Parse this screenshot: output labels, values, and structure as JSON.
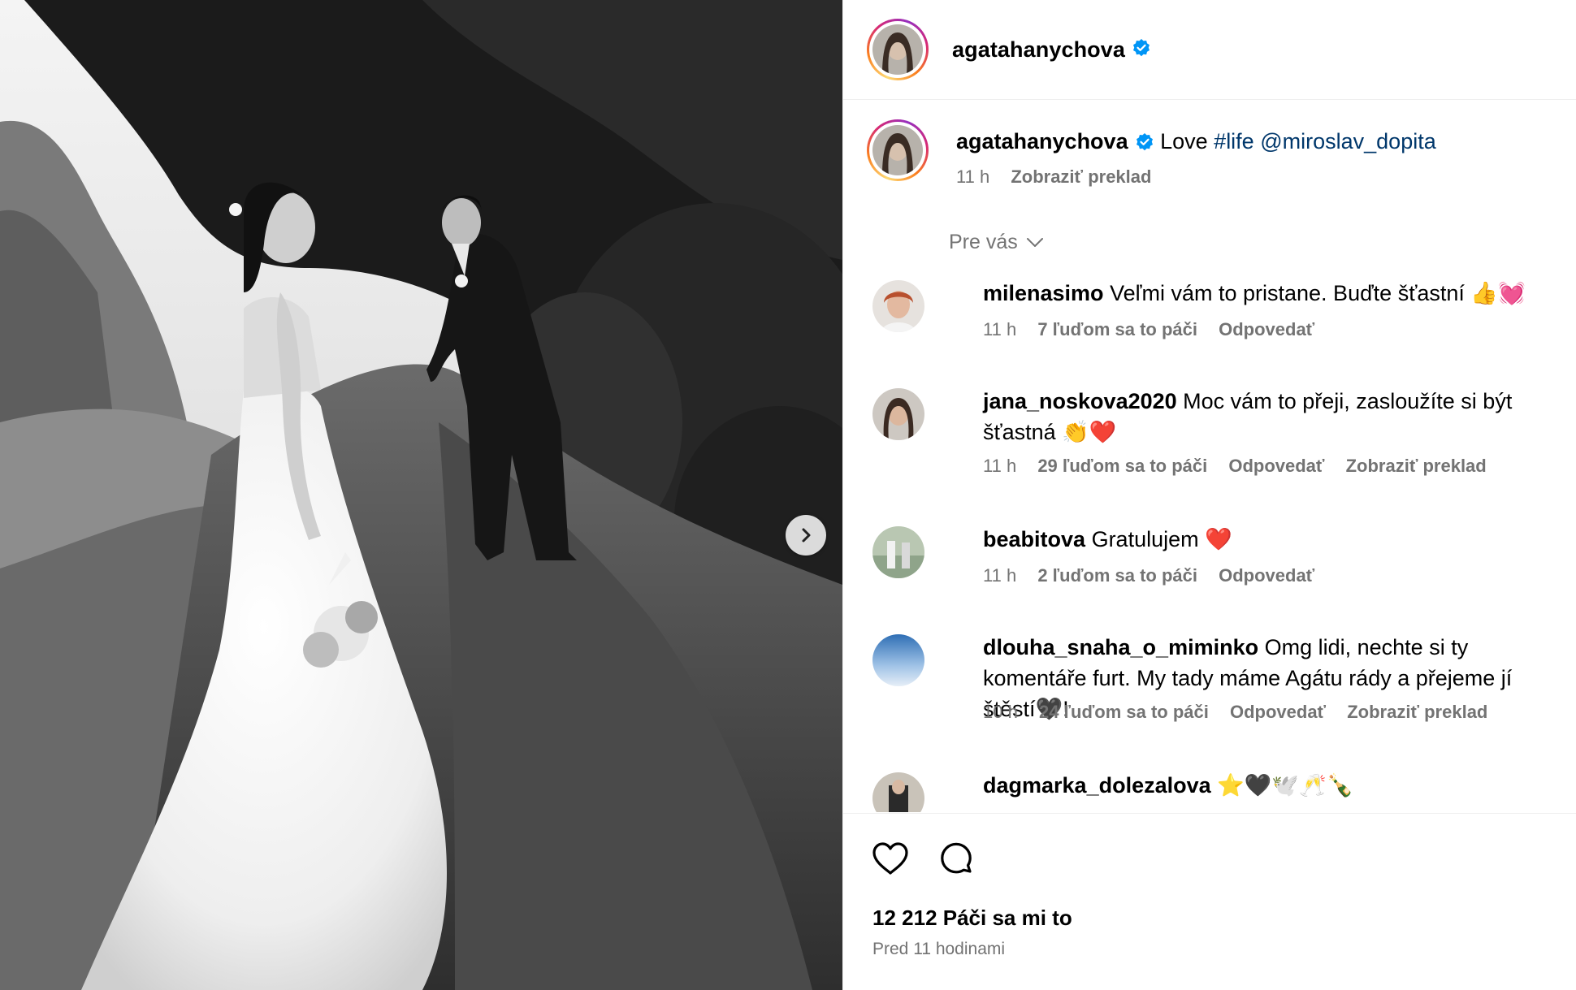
{
  "post": {
    "username": "agatahanychova",
    "caption_text": "Love ",
    "caption_hashtag": "#life",
    "caption_mention": "@miroslav_dopita",
    "time": "11 h",
    "translate_label": "Zobraziť preklad"
  },
  "sort_label": "Pre vás",
  "comments": [
    {
      "username": "milenasimo",
      "text": "Veľmi vám to pristane. Buďte šťastní 👍💓",
      "time": "11 h",
      "likes": "7 ľuďom sa to páči",
      "reply": "Odpovedať",
      "translate": ""
    },
    {
      "username": "jana_noskova2020",
      "text": "Moc vám to přeji, zasloužíte si být šťastná 👏❤️",
      "time": "11 h",
      "likes": "29 ľuďom sa to páči",
      "reply": "Odpovedať",
      "translate": "Zobraziť preklad"
    },
    {
      "username": "beabitova",
      "text": "Gratulujem ❤️",
      "time": "11 h",
      "likes": "2 ľuďom sa to páči",
      "reply": "Odpovedať",
      "translate": ""
    },
    {
      "username": "dlouha_snaha_o_miminko",
      "text": "Omg lidi, nechte si ty komentáře furt. My tady máme Agátu rády a přejeme jí štěstí🖤!",
      "time": "10 h",
      "likes": "24 ľuďom sa to páči",
      "reply": "Odpovedať",
      "translate": "Zobraziť preklad"
    },
    {
      "username": "dagmarka_dolezalova",
      "text": "⭐️🖤🕊️🥂🍾",
      "time": "",
      "likes": "",
      "reply": "",
      "translate": ""
    }
  ],
  "likes_label": "12 212 Páči sa mi to",
  "date_label": "Pred 11 hodinami",
  "icons": [
    "verified-icon",
    "chevron-down-icon",
    "heart-icon",
    "comment-icon",
    "chevron-right-icon"
  ],
  "colors": {
    "link": "#00376b",
    "verified": "#0095f6",
    "meta": "#737373"
  }
}
